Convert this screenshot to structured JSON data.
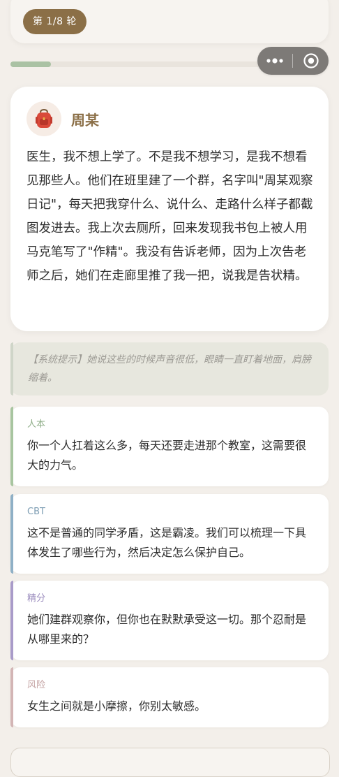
{
  "header": {
    "round_label": "第 1/8 轮",
    "progress_fraction": 0.16
  },
  "speaker": {
    "avatar_icon": "backpack-icon",
    "name": "周某",
    "text": "医生，我不想上学了。不是我不想学习，是我不想看见那些人。他们在班里建了一个群，名字叫\"周某观察日记\"，每天把我穿什么、说什么、走路什么样子都截图发进去。我上次去厕所，回来发现我书包上被人用马克笔写了\"作精\"。我没有告诉老师，因为上次告老师之后，她们在走廊里推了我一把，说我是告状精。"
  },
  "hint": {
    "text": "【系统提示】她说这些的时候声音很低，眼睛一直盯着地面，肩膀缩着。"
  },
  "options": [
    {
      "tag": "人本",
      "text": "你一个人扛着这么多，每天还要走进那个教室，这需要很大的力气。",
      "accent": "#a8c5a0",
      "tag_color": "#8fae88"
    },
    {
      "tag": "CBT",
      "text": "这不是普通的同学矛盾，这是霸凌。我们可以梳理一下具体发生了哪些行为，然后决定怎么保护自己。",
      "accent": "#8fb0c6",
      "tag_color": "#7d9db3"
    },
    {
      "tag": "精分",
      "text": "她们建群观察你，但你也在默默承受这一切。那个忍耐是从哪里来的？",
      "accent": "#a99bc9",
      "tag_color": "#9a8bbd"
    },
    {
      "tag": "风险",
      "text": "女生之间就是小摩擦，你别太敏感。",
      "accent": "#d3b5b5",
      "tag_color": "#c4a3a3"
    }
  ],
  "colors": {
    "badge": "#8b6f47",
    "progress": "#aac2a4",
    "background": "#f3efea"
  }
}
